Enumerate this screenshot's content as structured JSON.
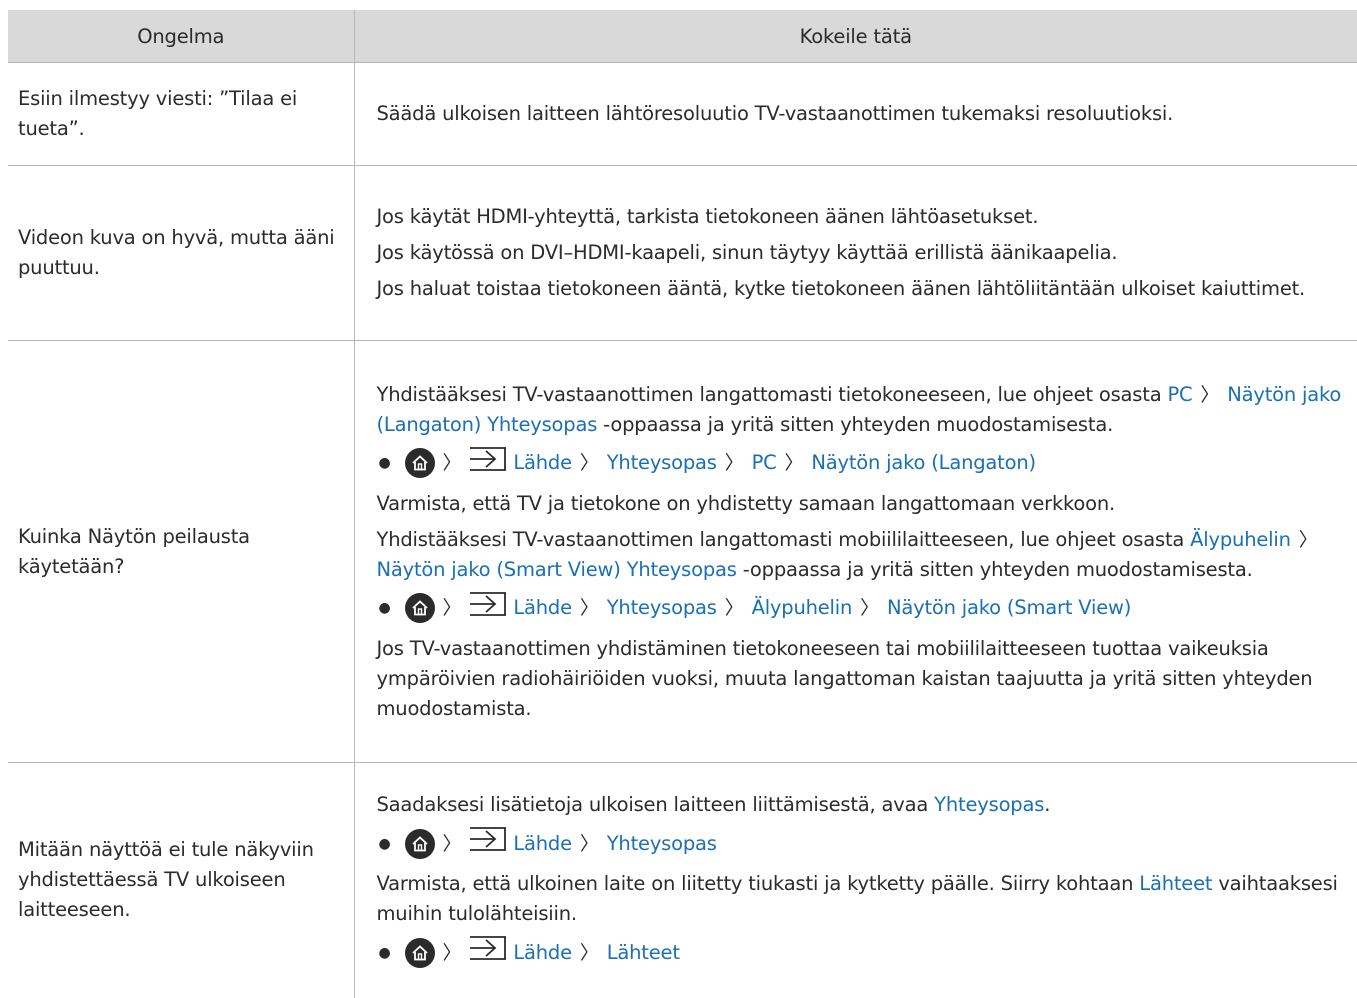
{
  "header": {
    "col1": "Ongelma",
    "col2": "Kokeile tätä"
  },
  "rows": {
    "r1": {
      "problem": "Esiin ilmestyy viesti: ”Tilaa ei tueta”.",
      "p1": "Säädä ulkoisen laitteen lähtöresoluutio TV-vastaanottimen tukemaksi resoluutioksi."
    },
    "r2": {
      "problem": "Videon kuva on hyvä, mutta ääni puuttuu.",
      "p1": "Jos käytät HDMI-yhteyttä, tarkista tietokoneen äänen lähtöasetukset.",
      "p2": "Jos käytössä on DVI–HDMI-kaapeli, sinun täytyy käyttää erillistä äänikaapelia.",
      "p3": "Jos haluat toistaa tietokoneen ääntä, kytke tietokoneen äänen lähtöliitäntään ulkoiset kaiuttimet."
    },
    "r3": {
      "problem": "Kuinka Näytön peilausta käytetään?",
      "p1_a": "Yhdistääksesi TV-vastaanottimen langattomasti tietokoneeseen, lue ohjeet osasta ",
      "p1_link1": "PC",
      "p1_link2": "Näytön jako (Langaton) Yhteysopas",
      "p1_b": " -oppaassa ja yritä sitten yhteyden muodostamisesta.",
      "path1": [
        "Lähde",
        "Yhteysopas",
        "PC",
        "Näytön jako (Langaton)"
      ],
      "p2": "Varmista, että TV ja tietokone on yhdistetty samaan langattomaan verkkoon.",
      "p3_a": "Yhdistääksesi TV-vastaanottimen langattomasti mobiililaitteeseen, lue ohjeet osasta ",
      "p3_link1": "Älypuhelin",
      "p3_link2": "Näytön jako (Smart View) Yhteysopas",
      "p3_b": " -oppaassa ja yritä sitten yhteyden muodostamisesta.",
      "path2": [
        "Lähde",
        "Yhteysopas",
        "Älypuhelin",
        "Näytön jako (Smart View)"
      ],
      "p4": "Jos TV-vastaanottimen yhdistäminen tietokoneeseen tai mobiililaitteeseen tuottaa vaikeuksia ympäröivien radiohäiriöiden vuoksi, muuta langattoman kaistan taajuutta ja yritä sitten yhteyden muodostamista."
    },
    "r4": {
      "problem": "Mitään näyttöä ei tule näkyviin yhdistettäessä TV ulkoiseen laitteeseen.",
      "p1_a": "Saadaksesi lisätietoja ulkoisen laitteen liittämisestä, avaa ",
      "p1_link": "Yhteysopas",
      "p1_b": ".",
      "path1": [
        "Lähde",
        "Yhteysopas"
      ],
      "p2_a": "Varmista, että ulkoinen laite on liitetty tiukasti ja kytketty päälle. Siirry kohtaan ",
      "p2_link": "Lähteet",
      "p2_b": " vaihtaaksesi muihin tulolähteisiin.",
      "path2": [
        "Lähde",
        "Lähteet"
      ]
    }
  },
  "icons": {
    "home": "home-icon",
    "source": "source-input-icon",
    "chevron": "chevron-right-icon"
  },
  "colors": {
    "link": "#1a6fb5",
    "header_bg": "#d9d9d9",
    "text": "#2b2b2b",
    "divider": "#b8b8b8"
  }
}
